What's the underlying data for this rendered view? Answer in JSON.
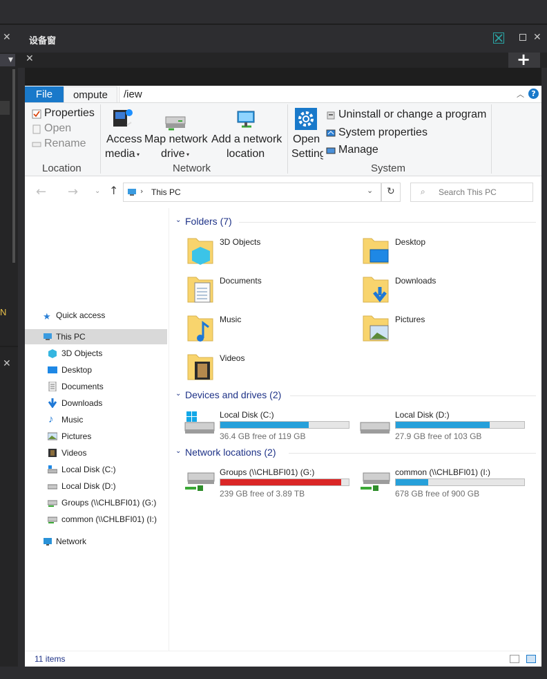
{
  "host": {
    "panel_title": "设备窗",
    "side_text": "N"
  },
  "ribbon": {
    "tabs": {
      "file": "File",
      "computer": "ompute",
      "view": "/iew"
    },
    "location": {
      "properties": "Properties",
      "open": "Open",
      "rename": "Rename",
      "label": "Location"
    },
    "network": {
      "access_media_1": "Access",
      "access_media_2": "media",
      "map_drive_1": "Map network",
      "map_drive_2": "drive",
      "add_location_1": "Add a network",
      "add_location_2": "location",
      "label": "Network"
    },
    "system": {
      "open_settings_1": "Open",
      "open_settings_2": "Setting",
      "uninstall": "Uninstall or change a program",
      "system_properties": "System properties",
      "manage": "Manage",
      "label": "System"
    }
  },
  "navbar": {
    "address": "This PC",
    "search_placeholder": "Search This PC"
  },
  "nav": {
    "quick_access": "Quick access",
    "this_pc": "This PC",
    "items": [
      "3D Objects",
      "Desktop",
      "Documents",
      "Downloads",
      "Music",
      "Pictures",
      "Videos",
      "Local Disk (C:)",
      "Local Disk (D:)",
      "Groups (\\\\CHLBFI01) (G:)",
      "common (\\\\CHLBFI01) (I:)"
    ],
    "network": "Network"
  },
  "folders": {
    "heading": "Folders (7)",
    "items": [
      "3D Objects",
      "Desktop",
      "Documents",
      "Downloads",
      "Music",
      "Pictures",
      "Videos"
    ]
  },
  "devices": {
    "heading": "Devices and drives (2)",
    "drives": [
      {
        "name": "Local Disk (C:)",
        "free": "36.4 GB free of 119 GB",
        "used_fraction": 0.69,
        "color": "#26a0da"
      },
      {
        "name": "Local Disk (D:)",
        "free": "27.9 GB free of 103 GB",
        "used_fraction": 0.73,
        "color": "#26a0da"
      }
    ]
  },
  "network_locations": {
    "heading": "Network locations (2)",
    "drives": [
      {
        "name": "Groups (\\\\CHLBFI01) (G:)",
        "free": "239 GB free of 3.89 TB",
        "used_fraction": 0.94,
        "color": "#da2626"
      },
      {
        "name": "common (\\\\CHLBFI01) (I:)",
        "free": "678 GB free of 900 GB",
        "used_fraction": 0.25,
        "color": "#26a0da"
      }
    ]
  },
  "status": {
    "count": "11 items"
  }
}
